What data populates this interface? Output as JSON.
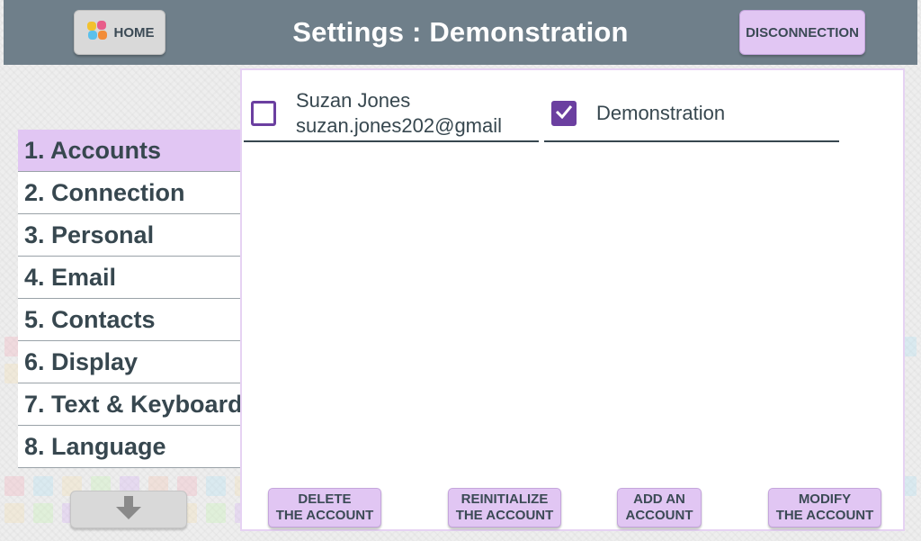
{
  "header": {
    "title": "Settings : Demonstration",
    "home_label": "HOME",
    "disconnect_label": "DISCONNECTION"
  },
  "sidebar": {
    "items": [
      {
        "label": "1. Accounts",
        "active": true
      },
      {
        "label": "2. Connection"
      },
      {
        "label": "3. Personal"
      },
      {
        "label": "4. Email"
      },
      {
        "label": "5. Contacts"
      },
      {
        "label": "6. Display"
      },
      {
        "label": "7. Text & Keyboard"
      },
      {
        "label": "8. Language"
      }
    ],
    "scroll_down_icon": "arrow-down-icon"
  },
  "accounts": [
    {
      "name": "Suzan Jones",
      "email": "suzan.jones202@gmail",
      "checked": false
    },
    {
      "name": "Demonstration",
      "checked": true
    }
  ],
  "actions": {
    "delete": "DELETE\nTHE ACCOUNT",
    "reinitialize": "REINITIALIZE\nTHE ACCOUNT",
    "add": "ADD AN\nACCOUNT",
    "modify": "MODIFY\nTHE ACCOUNT"
  },
  "colors": {
    "header_bg": "#6f7f8a",
    "accent": "#e1c6f3",
    "checkbox": "#6b3fa0",
    "text": "#37474f"
  }
}
